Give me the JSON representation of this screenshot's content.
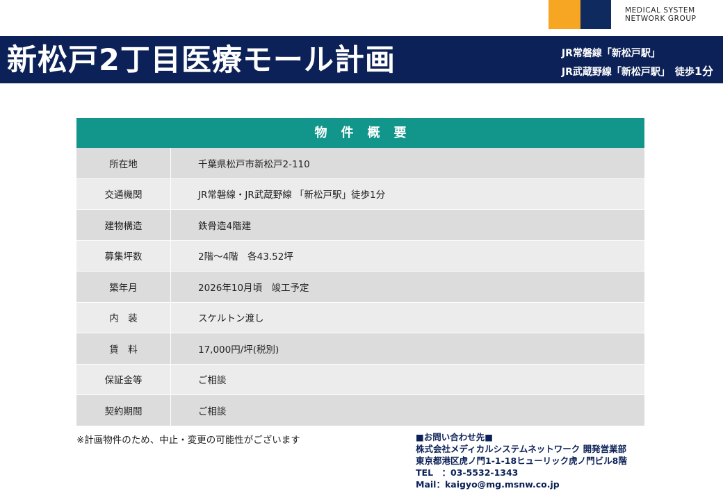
{
  "logo": {
    "line1": "MEDICAL SYSTEM",
    "line2": "NETWORK GROUP",
    "colors": {
      "orange": "#f6a623",
      "navy": "#0e2a5e"
    }
  },
  "header": {
    "title": "新松戸2丁目医療モール計画",
    "access_line1": "JR常磐線「新松戸駅」",
    "access_line2_station": "JR武蔵野線「新松戸駅」　徒歩",
    "access_line2_minutes": "1分",
    "background": "#0c2157"
  },
  "property": {
    "heading": "物件概要",
    "heading_color": "#12968c",
    "rows": [
      {
        "label": "所在地",
        "value": "千葉県松戸市新松戸2-110"
      },
      {
        "label": "交通機関",
        "value": "JR常磐線・JR武蔵野線 「新松戸駅」徒歩1分"
      },
      {
        "label": "建物構造",
        "value": "鉄骨造4階建"
      },
      {
        "label": "募集坪数",
        "value": "2階～4階　各43.52坪"
      },
      {
        "label": "築年月",
        "value": "2026年10月頃　竣工予定"
      },
      {
        "label": "内　装",
        "value": "スケルトン渡し"
      },
      {
        "label": "賃　料",
        "value": "17,000円/坪(税別)"
      },
      {
        "label": "保証金等",
        "value": "ご相談"
      },
      {
        "label": "契約期間",
        "value": "ご相談"
      }
    ]
  },
  "footer": {
    "note": "※計画物件のため、中止・変更の可能性がございます",
    "contact_heading": "■お問い合わせ先■",
    "company": "株式会社メディカルシステムネットワーク 開発営業部",
    "address": "東京都港区虎ノ門1-1-18ヒューリック虎ノ門ビル8階",
    "tel": "TEL　：03-5532-1343",
    "mail": "Mail：kaigyo@mg.msnw.co.jp"
  }
}
